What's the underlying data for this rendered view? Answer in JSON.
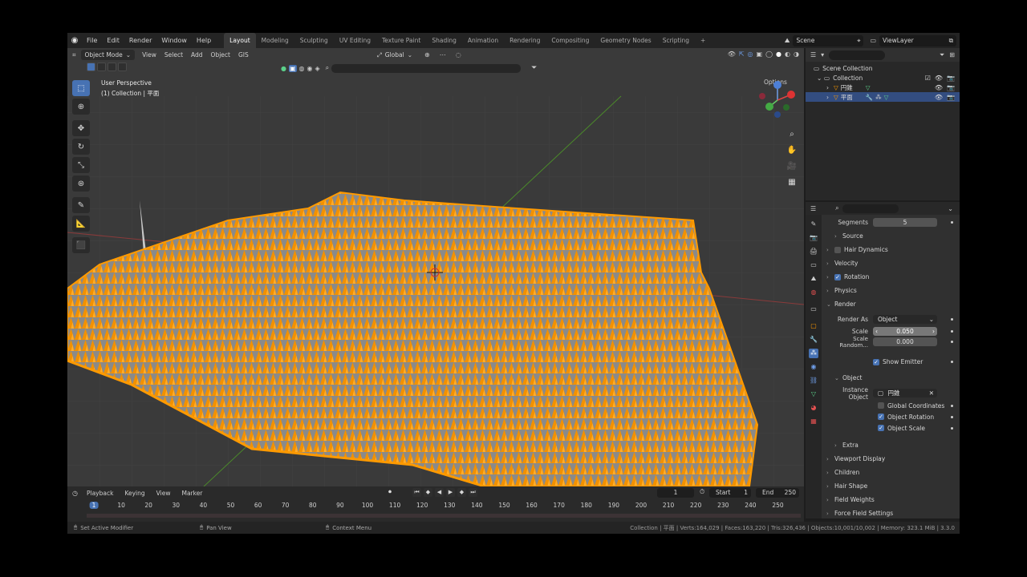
{
  "topbar": {
    "menus": [
      "File",
      "Edit",
      "Render",
      "Window",
      "Help"
    ],
    "workspaces": [
      "Layout",
      "Modeling",
      "Sculpting",
      "UV Editing",
      "Texture Paint",
      "Shading",
      "Animation",
      "Rendering",
      "Compositing",
      "Geometry Nodes",
      "Scripting"
    ],
    "active_workspace": "Layout",
    "add_tab": "+",
    "scene": "Scene",
    "view_layer": "ViewLayer"
  },
  "viewport": {
    "mode": "Object Mode",
    "menus": [
      "View",
      "Select",
      "Add",
      "Object",
      "GIS"
    ],
    "transform_orientation": "Global",
    "perspective": "User Perspective",
    "collection_info": "(1) Collection | 平面",
    "options": "Options",
    "colors": {
      "selection": "#ff9a00",
      "background": "#3a3a3a",
      "grid": "#474747",
      "x_axis": "#8a3a3a",
      "y_axis": "#4b8a2a"
    }
  },
  "outliner": {
    "search_placeholder": "",
    "root": "Scene Collection",
    "collection": "Collection",
    "objects": [
      {
        "name": "円錐",
        "selected": false
      },
      {
        "name": "平面",
        "selected": true
      }
    ]
  },
  "properties": {
    "segments_label": "Segments",
    "segments_value": "5",
    "panels": {
      "source": "Source",
      "hair_dynamics": "Hair Dynamics",
      "velocity": "Velocity",
      "rotation": "Rotation",
      "physics": "Physics",
      "render": "Render",
      "object": "Object",
      "extra": "Extra",
      "viewport_display": "Viewport Display",
      "children": "Children",
      "hair_shape": "Hair Shape",
      "field_weights": "Field Weights",
      "force_field": "Force Field Settings"
    },
    "render_as_label": "Render As",
    "render_as_value": "Object",
    "scale_label": "Scale",
    "scale_value": "0.050",
    "scale_random_label": "Scale Random...",
    "scale_random_value": "0.000",
    "show_emitter": "Show Emitter",
    "instance_object_label": "Instance Object",
    "instance_object_value": "円錐",
    "global_coordinates": "Global Coordinates",
    "object_rotation": "Object Rotation",
    "object_scale": "Object Scale"
  },
  "timeline": {
    "menus": [
      "Playback",
      "Keying",
      "View",
      "Marker"
    ],
    "current_frame": "1",
    "start_label": "Start",
    "start_value": "1",
    "end_label": "End",
    "end_value": "250",
    "ruler": [
      "1",
      "10",
      "20",
      "30",
      "40",
      "50",
      "60",
      "70",
      "80",
      "90",
      "100",
      "110",
      "120",
      "130",
      "140",
      "150",
      "160",
      "170",
      "180",
      "190",
      "200",
      "210",
      "220",
      "230",
      "240",
      "250"
    ]
  },
  "statusbar": {
    "left_action": "Set Active Modifier",
    "middle_action": "Pan View",
    "right_action": "Context Menu",
    "stats": "Collection | 平面 | Verts:164,029 | Faces:163,220 | Tris:326,436 | Objects:10,001/10,002 | Memory: 323.1 MiB | 3.3.0"
  }
}
